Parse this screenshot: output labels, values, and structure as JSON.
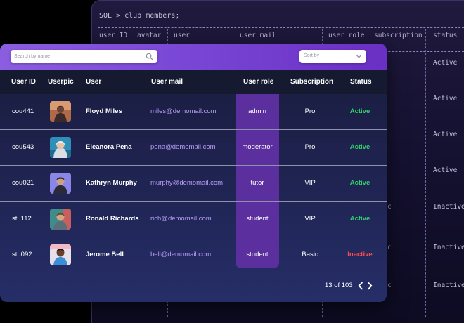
{
  "sql_panel": {
    "title": "SQL > club members;",
    "columns": [
      "user_ID",
      "avatar",
      "user",
      "user_mail",
      "user_role",
      "subscription",
      "status"
    ],
    "status_values": [
      "Active",
      "Active",
      "Active",
      "Active",
      "Inactive",
      "Inactive",
      "Inactive"
    ],
    "edge_text": "c"
  },
  "search": {
    "placeholder": "Search by name"
  },
  "sort": {
    "label": "Sort by"
  },
  "table": {
    "headers": {
      "user_id": "User ID",
      "userpic": "Userpic",
      "user": "User",
      "mail": "User mail",
      "role": "User role",
      "subscription": "Subscription",
      "status": "Status"
    },
    "rows": [
      {
        "user_id": "cou441",
        "user": "Floyd Miles",
        "mail": "miles@demomail.com",
        "role": "admin",
        "subscription": "Pro",
        "status": "Active"
      },
      {
        "user_id": "cou543",
        "user": "Eleanora Pena",
        "mail": "pena@demomail.com",
        "role": "moderator",
        "subscription": "Pro",
        "status": "Active"
      },
      {
        "user_id": "cou021",
        "user": "Kathryn Murphy",
        "mail": "murphy@demomail.com",
        "role": "tutor",
        "subscription": "VIP",
        "status": "Active"
      },
      {
        "user_id": "stu112",
        "user": "Ronald Richards",
        "mail": "rich@demomail.com",
        "role": "student",
        "subscription": "VIP",
        "status": "Active"
      },
      {
        "user_id": "stu092",
        "user": "Jerome Bell",
        "mail": "bell@demomail.com",
        "role": "student",
        "subscription": "Basic",
        "status": "Inactive"
      }
    ]
  },
  "pagination": {
    "text": "13 of 103"
  },
  "colors": {
    "accent_purple": "#7a48d6",
    "role_highlight": "#5b2f9e",
    "status_active": "#2fd36b",
    "status_inactive": "#ff4b4b",
    "mail_text": "#b79cf4"
  },
  "icons": {
    "search": "search-icon",
    "sort": "chevron-down-icon",
    "prev": "chevron-left-icon",
    "next": "chevron-right-icon"
  }
}
